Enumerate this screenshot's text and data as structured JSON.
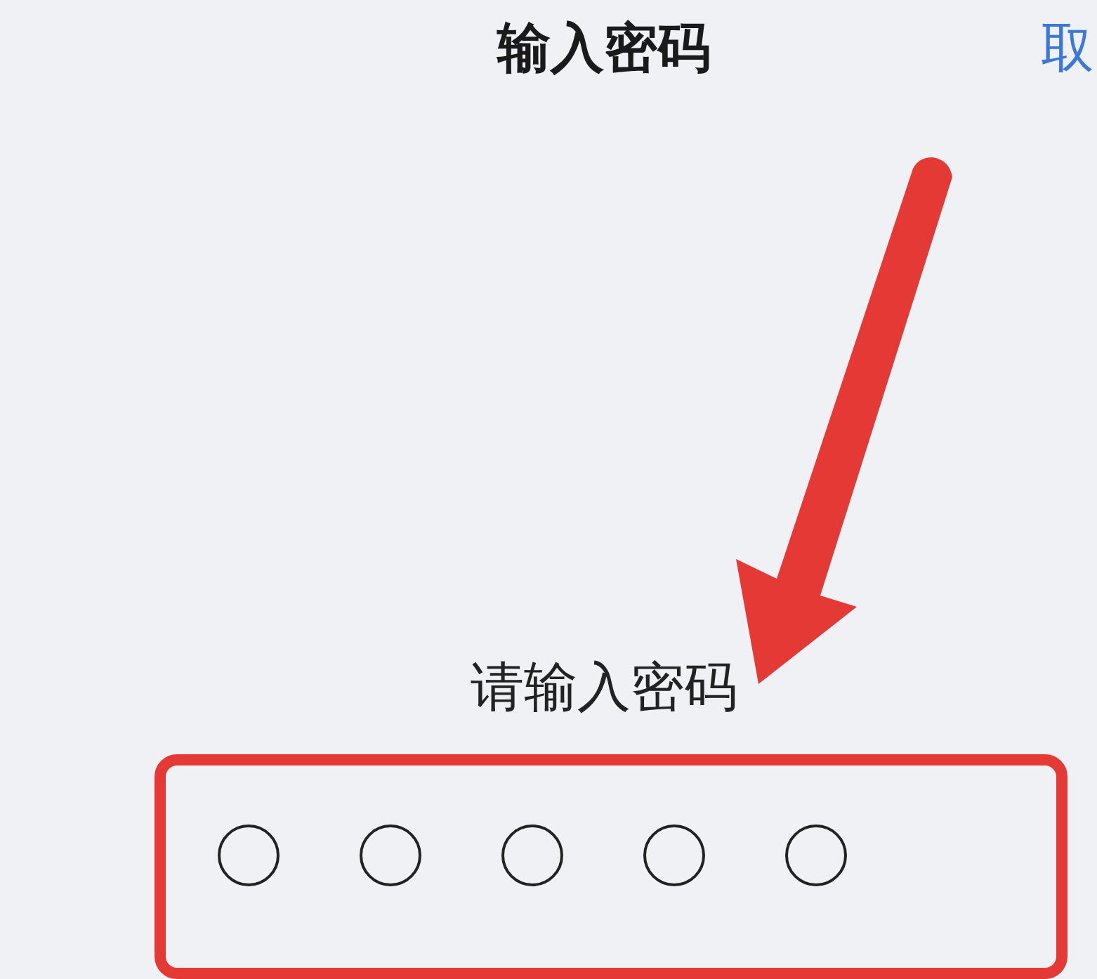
{
  "header": {
    "title": "输入密码",
    "cancel": "取"
  },
  "prompt": "请输入密码",
  "passcode_dots": [
    {
      "filled": false
    },
    {
      "filled": false
    },
    {
      "filled": false
    },
    {
      "filled": false
    },
    {
      "filled": false
    }
  ]
}
